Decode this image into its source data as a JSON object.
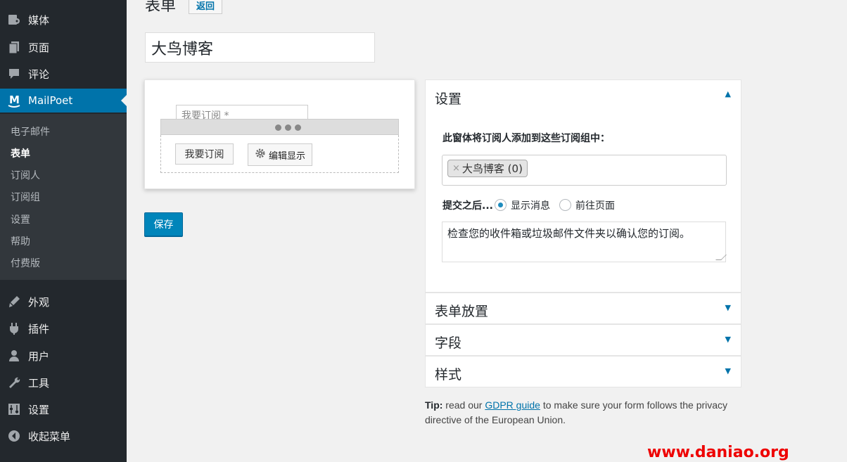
{
  "sidebar": {
    "items_top": [
      {
        "label": "媒体",
        "icon": "media-icon"
      },
      {
        "label": "页面",
        "icon": "pages-icon"
      },
      {
        "label": "评论",
        "icon": "comments-icon"
      },
      {
        "label": "MailPoet",
        "icon": "mailpoet-icon"
      }
    ],
    "submenu": [
      "电子邮件",
      "表单",
      "订阅人",
      "订阅组",
      "设置",
      "帮助",
      "付费版"
    ],
    "items_bottom": [
      {
        "label": "外观",
        "icon": "appearance-icon"
      },
      {
        "label": "插件",
        "icon": "plugins-icon"
      },
      {
        "label": "用户",
        "icon": "users-icon"
      },
      {
        "label": "工具",
        "icon": "tools-icon"
      },
      {
        "label": "设置",
        "icon": "settings-icon"
      },
      {
        "label": "收起菜单",
        "icon": "collapse-icon"
      }
    ]
  },
  "header": {
    "title": "表单",
    "back_label": "返回"
  },
  "form_name": "大鸟博客",
  "preview": {
    "input_placeholder": "我要订阅 *",
    "subscribe_label": "我要订阅",
    "edit_display_label": "编辑显示"
  },
  "save_label": "保存",
  "settings": {
    "title": "设置",
    "list_label": "此窗体将订阅人添加到这些订阅组中：",
    "list_chip_remove": "×",
    "list_chip": "大鸟博客 (0)",
    "after_submit_label": "提交之后...",
    "radio_show_message": "显示消息",
    "radio_go_page": "前往页面",
    "message": "检查您的收件箱或垃圾邮件文件夹以确认您的订阅。"
  },
  "panels": {
    "placement": "表单放置",
    "fields": "字段",
    "styles": "样式"
  },
  "tip": {
    "prefix": "Tip:",
    "text1": " read our ",
    "link": "GDPR guide",
    "text2": " to make sure your form follows the privacy directive of the European Union."
  },
  "watermark": "www.daniao.org",
  "colors": {
    "sidebar": "#23282d",
    "submenu": "#32373c",
    "accent": "#0073aa",
    "button": "#0085ba"
  }
}
